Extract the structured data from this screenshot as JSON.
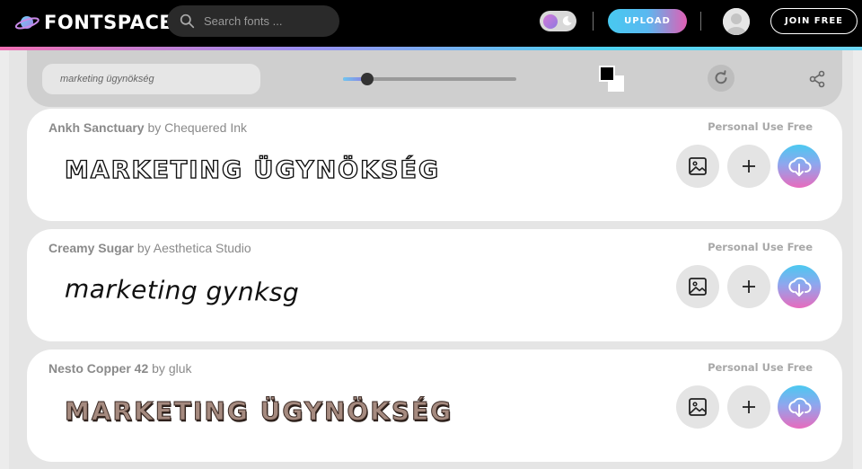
{
  "header": {
    "logo_text": "FONTSPACE",
    "search_placeholder": "Search fonts ...",
    "upload_label": "UPLOAD",
    "join_label": "JOIN FREE"
  },
  "toolbar": {
    "preview_text": "marketing ügynökség",
    "size_slider_fraction": 0.14,
    "foreground_color": "#000000",
    "background_color": "#ffffff"
  },
  "fonts": [
    {
      "name": "Ankh Sanctuary",
      "by": "by",
      "author": "Chequered Ink",
      "license": "Personal Use Free",
      "sample": "MARKETING ÜGYNÖKSÉG"
    },
    {
      "name": "Creamy Sugar",
      "by": "by",
      "author": "Aesthetica Studio",
      "license": "Personal Use Free",
      "sample": "marketing gynksg"
    },
    {
      "name": "Nesto Copper 42",
      "by": "by",
      "author": "gluk",
      "license": "Personal Use Free",
      "sample": "MARKETING ÜGYNÖKSÉG"
    }
  ],
  "colors": {
    "accent_blue": "#48c9f0",
    "accent_pink": "#e05fb4",
    "accent_purple": "#8f79e0"
  },
  "icons": {
    "logo": "planet-icon",
    "search": "search-icon",
    "theme": "moon-icon",
    "avatar": "user-avatar-icon",
    "refresh": "refresh-icon",
    "share": "share-icon",
    "image": "image-icon",
    "add": "plus-icon",
    "download": "cloud-download-icon"
  }
}
